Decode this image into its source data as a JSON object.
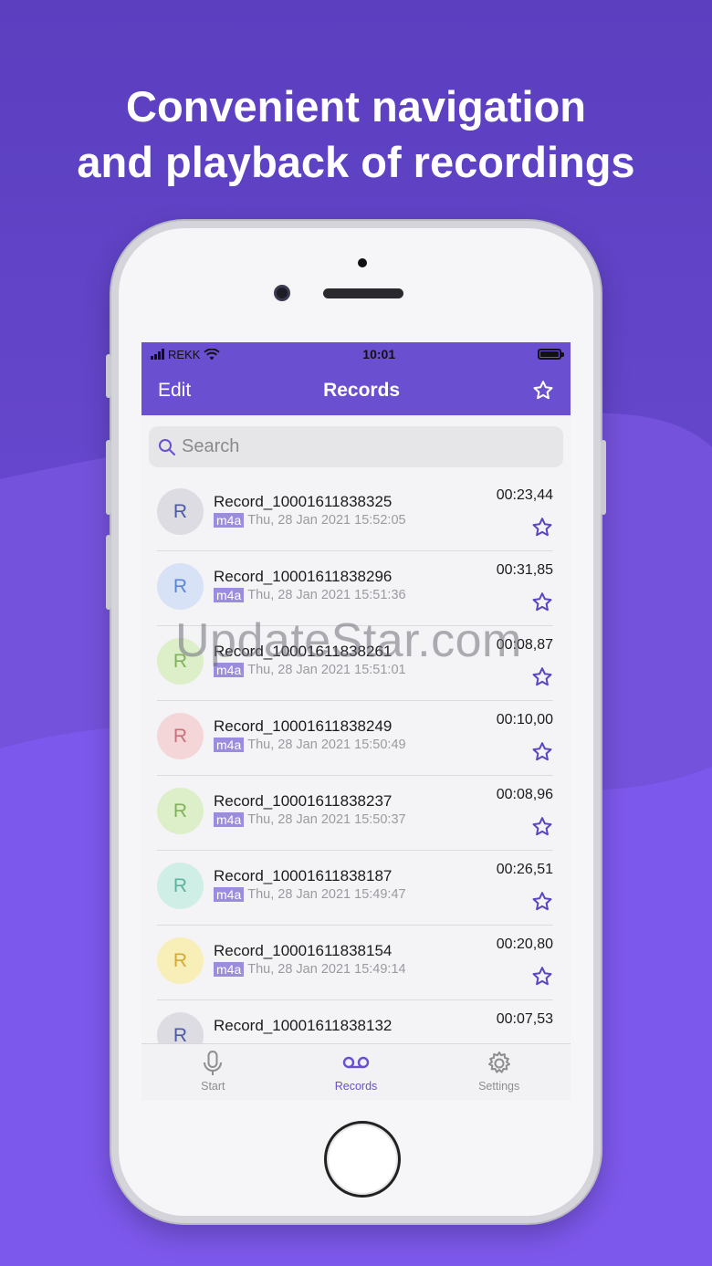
{
  "headline": {
    "line1": "Convenient navigation",
    "line2": "and playback of recordings"
  },
  "status_bar": {
    "carrier": "REKK",
    "time": "10:01"
  },
  "nav": {
    "edit_label": "Edit",
    "title": "Records",
    "favorite_icon": "star-outline-icon"
  },
  "search": {
    "placeholder": "Search"
  },
  "records": [
    {
      "initial": "R",
      "name": "Record_10001611838325",
      "format": "m4a",
      "date": "Thu, 28 Jan 2021 15:52:05",
      "duration": "00:23,44",
      "avatar_bg": "#dcdce2",
      "avatar_fg": "#4b5aa8"
    },
    {
      "initial": "R",
      "name": "Record_10001611838296",
      "format": "m4a",
      "date": "Thu, 28 Jan 2021 15:51:36",
      "duration": "00:31,85",
      "avatar_bg": "#d8e2f6",
      "avatar_fg": "#5b86d8"
    },
    {
      "initial": "R",
      "name": "Record_10001611838261",
      "format": "m4a",
      "date": "Thu, 28 Jan 2021 15:51:01",
      "duration": "00:08,87",
      "avatar_bg": "#dcefc8",
      "avatar_fg": "#7fb25a"
    },
    {
      "initial": "R",
      "name": "Record_10001611838249",
      "format": "m4a",
      "date": "Thu, 28 Jan 2021 15:50:49",
      "duration": "00:10,00",
      "avatar_bg": "#f4d6d9",
      "avatar_fg": "#c9707a"
    },
    {
      "initial": "R",
      "name": "Record_10001611838237",
      "format": "m4a",
      "date": "Thu, 28 Jan 2021 15:50:37",
      "duration": "00:08,96",
      "avatar_bg": "#dcefc8",
      "avatar_fg": "#7fb25a"
    },
    {
      "initial": "R",
      "name": "Record_10001611838187",
      "format": "m4a",
      "date": "Thu, 28 Jan 2021 15:49:47",
      "duration": "00:26,51",
      "avatar_bg": "#cfeee6",
      "avatar_fg": "#5bb3a0"
    },
    {
      "initial": "R",
      "name": "Record_10001611838154",
      "format": "m4a",
      "date": "Thu, 28 Jan 2021 15:49:14",
      "duration": "00:20,80",
      "avatar_bg": "#f7eeb8",
      "avatar_fg": "#d4a938"
    },
    {
      "initial": "R",
      "name": "Record_10001611838132",
      "format": "",
      "date": "",
      "duration": "00:07,53",
      "avatar_bg": "#dcdce2",
      "avatar_fg": "#4b5aa8"
    }
  ],
  "tabs": [
    {
      "label": "Start",
      "icon": "microphone-icon",
      "active": false
    },
    {
      "label": "Records",
      "icon": "voicemail-icon",
      "active": true
    },
    {
      "label": "Settings",
      "icon": "gear-icon",
      "active": false
    }
  ],
  "watermark": "UpdateStar.com",
  "colors": {
    "accent": "#6a4fd0",
    "background": "#6a4ad2",
    "badge": "#9c8ce0"
  }
}
